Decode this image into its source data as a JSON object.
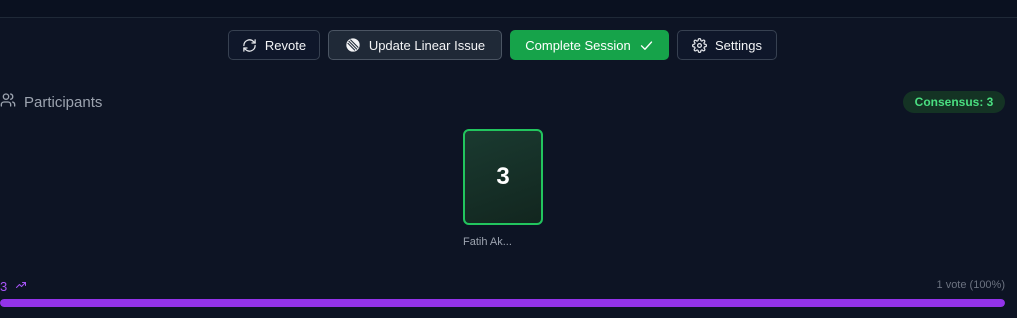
{
  "toolbar": {
    "revote_label": "Revote",
    "update_linear_label": "Update Linear Issue",
    "complete_session_label": "Complete Session",
    "settings_label": "Settings"
  },
  "participants": {
    "header_label": "Participants",
    "consensus_label": "Consensus: 3",
    "cards": [
      {
        "value": "3",
        "name": "Fatih Ak..."
      }
    ]
  },
  "results": {
    "value": "3",
    "count_label": "1 vote (100%)",
    "progress": 1.0
  },
  "colors": {
    "background": "#0d1424",
    "accent_green": "#16a34a",
    "card_border": "#22c55e",
    "consensus_text": "#4ade80",
    "progress_fill": "#9333ea"
  },
  "icons": {
    "revote": "refresh-icon",
    "update_linear": "linear-logo-icon",
    "complete": "check-icon",
    "settings": "gear-icon",
    "participants": "users-icon",
    "trend": "trending-up-icon"
  }
}
